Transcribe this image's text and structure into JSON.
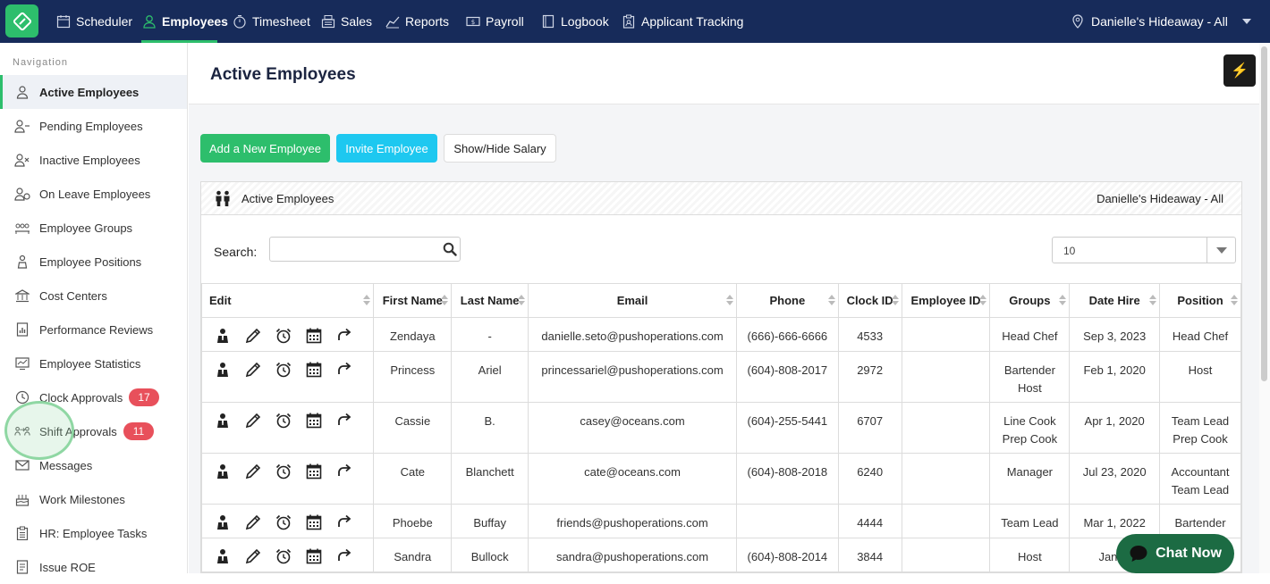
{
  "topbar": {
    "nav": [
      {
        "label": "Scheduler",
        "icon": "calendar-icon"
      },
      {
        "label": "Employees",
        "icon": "person-icon",
        "active": true
      },
      {
        "label": "Timesheet",
        "icon": "stopwatch-icon"
      },
      {
        "label": "Sales",
        "icon": "register-icon"
      },
      {
        "label": "Reports",
        "icon": "chart-line-icon"
      },
      {
        "label": "Payroll",
        "icon": "money-icon"
      },
      {
        "label": "Logbook",
        "icon": "book-icon"
      },
      {
        "label": "Applicant Tracking",
        "icon": "clipboard-icon"
      }
    ],
    "location": "Danielle's Hideaway - All"
  },
  "sidebar": {
    "title": "Navigation",
    "items": [
      {
        "label": "Active Employees",
        "icon": "person-icon",
        "active": true
      },
      {
        "label": "Pending Employees",
        "icon": "person-pending-icon"
      },
      {
        "label": "Inactive Employees",
        "icon": "person-x-icon"
      },
      {
        "label": "On Leave Employees",
        "icon": "person-leave-icon"
      },
      {
        "label": "Employee Groups",
        "icon": "group-icon"
      },
      {
        "label": "Employee Positions",
        "icon": "position-icon"
      },
      {
        "label": "Cost Centers",
        "icon": "bank-icon"
      },
      {
        "label": "Performance Reviews",
        "icon": "document-chart-icon"
      },
      {
        "label": "Employee Statistics",
        "icon": "statistics-icon"
      },
      {
        "label": "Clock Approvals",
        "icon": "clock-icon",
        "badge": "17"
      },
      {
        "label": "Shift Approvals",
        "icon": "shift-swap-icon",
        "badge": "11"
      },
      {
        "label": "Messages",
        "icon": "envelope-icon"
      },
      {
        "label": "Work Milestones",
        "icon": "cake-icon"
      },
      {
        "label": "HR: Employee Tasks",
        "icon": "clipboard-list-icon"
      },
      {
        "label": "Issue ROE",
        "icon": "document-icon"
      }
    ]
  },
  "main": {
    "title": "Active Employees",
    "buttons": {
      "add": "Add a New Employee",
      "invite": "Invite Employee",
      "salary": "Show/Hide Salary"
    },
    "panel": {
      "title": "Active Employees",
      "location": "Danielle's Hideaway - All"
    },
    "search": {
      "label": "Search:",
      "value": ""
    },
    "page_size": "10",
    "columns": [
      "Edit",
      "First Name",
      "Last Name",
      "Email",
      "Phone",
      "Clock ID",
      "Employee ID",
      "Groups",
      "Date Hire",
      "Position"
    ],
    "rows": [
      {
        "first": "Zendaya",
        "last": "-",
        "email": "danielle.seto@pushoperations.com",
        "phone": "(666)-666-6666",
        "clock": "4533",
        "empid": "",
        "groups": [
          "Head Chef"
        ],
        "hire": "Sep 3, 2023",
        "position": [
          "Head Chef"
        ]
      },
      {
        "first": "Princess",
        "last": "Ariel",
        "email": "princessariel@pushoperations.com",
        "phone": "(604)-808-2017",
        "clock": "2972",
        "empid": "",
        "groups": [
          "Bartender",
          "Host"
        ],
        "hire": "Feb 1, 2020",
        "position": [
          "Host"
        ]
      },
      {
        "first": "Cassie",
        "last": "B.",
        "email": "casey@oceans.com",
        "phone": "(604)-255-5441",
        "clock": "6707",
        "empid": "",
        "groups": [
          "Line Cook",
          "Prep Cook"
        ],
        "hire": "Apr 1, 2020",
        "position": [
          "Team Lead",
          "Prep Cook"
        ]
      },
      {
        "first": "Cate",
        "last": "Blanchett",
        "email": "cate@oceans.com",
        "phone": "(604)-808-2018",
        "clock": "6240",
        "empid": "",
        "groups": [
          "Manager"
        ],
        "hire": "Jul 23, 2020",
        "position": [
          "Accountant",
          "Team Lead"
        ]
      },
      {
        "first": "Phoebe",
        "last": "Buffay",
        "email": "friends@pushoperations.com",
        "phone": "",
        "clock": "4444",
        "empid": "",
        "groups": [
          "Team Lead"
        ],
        "hire": "Mar 1, 2022",
        "position": [
          "Bartender"
        ]
      },
      {
        "first": "Sandra",
        "last": "Bullock",
        "email": "sandra@pushoperations.com",
        "phone": "(604)-808-2014",
        "clock": "3844",
        "empid": "",
        "groups": [
          "Host"
        ],
        "hire": "Jan 1,",
        "position": [
          ""
        ]
      }
    ]
  },
  "chat": {
    "label": "Chat Now"
  },
  "colors": {
    "topbar": "#172b5a",
    "accent_green": "#2dbe6c",
    "invite_blue": "#1ec8f0",
    "badge_red": "#e8505b",
    "chat": "#1c6b43"
  }
}
